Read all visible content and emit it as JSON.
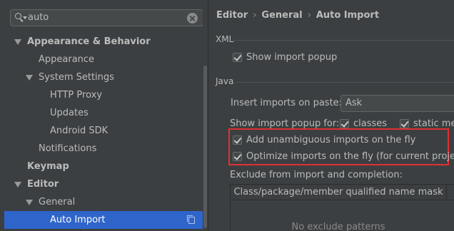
{
  "search": {
    "value": "auto"
  },
  "tree": [
    {
      "label": "Appearance & Behavior",
      "bold": true,
      "arrow": true,
      "level": 0
    },
    {
      "label": "Appearance",
      "bold": false,
      "arrow": false,
      "level": 1
    },
    {
      "label": "System Settings",
      "bold": false,
      "arrow": true,
      "level": 1
    },
    {
      "label": "HTTP Proxy",
      "bold": false,
      "arrow": false,
      "level": 2
    },
    {
      "label": "Updates",
      "bold": false,
      "arrow": false,
      "level": 2
    },
    {
      "label": "Android SDK",
      "bold": false,
      "arrow": false,
      "level": 2
    },
    {
      "label": "Notifications",
      "bold": false,
      "arrow": false,
      "level": 1
    },
    {
      "label": "Keymap",
      "bold": true,
      "arrow": false,
      "level": 0
    },
    {
      "label": "Editor",
      "bold": true,
      "arrow": true,
      "level": 0
    },
    {
      "label": "General",
      "bold": false,
      "arrow": true,
      "level": 1
    },
    {
      "label": "Auto Import",
      "bold": false,
      "arrow": false,
      "level": 2,
      "selected": true
    }
  ],
  "breadcrumb": {
    "part1": "Editor",
    "part2": "General",
    "part3": "Auto Import",
    "sep": "›"
  },
  "xml": {
    "title": "XML",
    "show_import_popup": {
      "label": "Show import popup",
      "checked": true
    }
  },
  "java": {
    "title": "Java",
    "insert_imports_label": "Insert imports on paste:",
    "insert_imports_value": "Ask",
    "show_popup_for_label": "Show import popup for:",
    "classes": {
      "label": "classes",
      "checked": true
    },
    "static_methods": {
      "label": "static met",
      "checked": true
    },
    "add_unambiguous": {
      "label": "Add unambiguous imports on the fly",
      "checked": true
    },
    "optimize_imports": {
      "label": "Optimize imports on the fly (for current project)",
      "checked": true
    },
    "exclude_label": "Exclude from import and completion:",
    "table_header": "Class/package/member qualified name mask",
    "table_empty": "No exclude patterns"
  },
  "colors": {
    "selection": "#2f65ca",
    "highlight_border": "#e03030",
    "background": "#3c3f41"
  }
}
